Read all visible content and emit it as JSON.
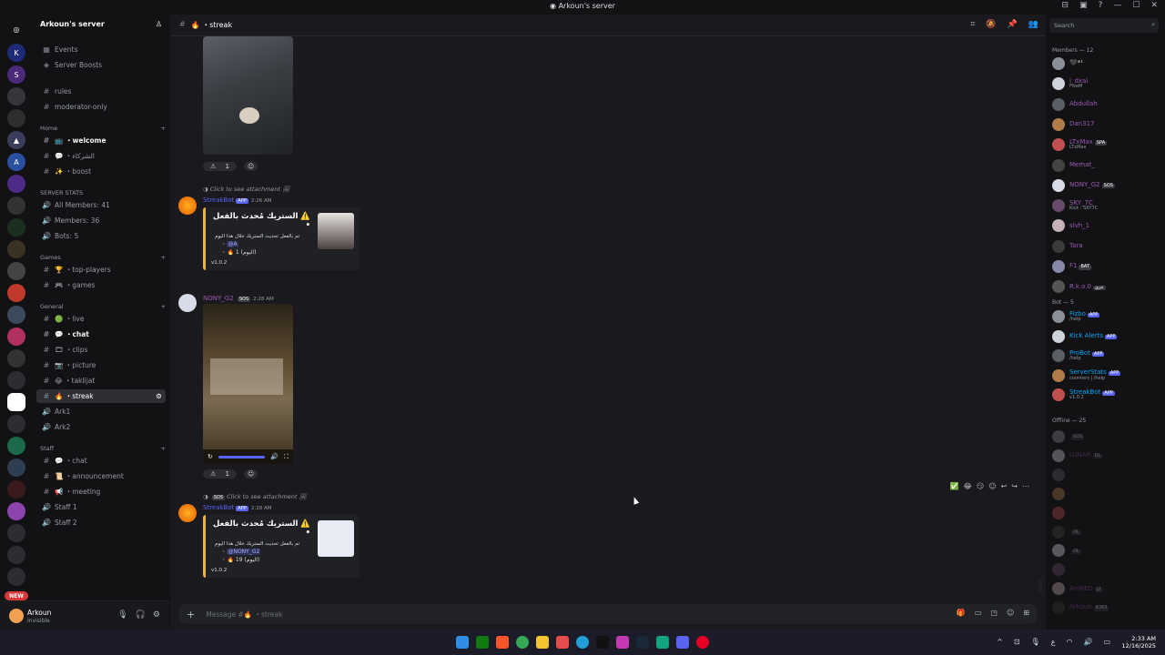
{
  "window": {
    "title": "Arkoun's server",
    "controls": [
      "pin",
      "inbox",
      "help",
      "minimize",
      "maximize",
      "close"
    ]
  },
  "sidebar": {
    "server_name": "Arkoun's server",
    "top_items": [
      {
        "label": "Events"
      },
      {
        "label": "Server Boosts"
      }
    ],
    "channels_top": [
      {
        "label": "rules"
      },
      {
        "label": "moderator-only"
      }
    ],
    "categories": [
      {
        "name": "Home",
        "channels": [
          {
            "label": "📺 ・welcome"
          },
          {
            "label": "💬 ・الشركاء"
          },
          {
            "label": "✨ ・boost"
          }
        ]
      },
      {
        "name": "SERVER STATS",
        "channels": [
          {
            "label": "All Members: 41"
          },
          {
            "label": "Members: 36"
          },
          {
            "label": "Bots: 5"
          }
        ]
      },
      {
        "name": "Games",
        "channels": [
          {
            "label": "🏆 ・top-players"
          },
          {
            "label": "🎮 ・games"
          }
        ]
      },
      {
        "name": "General",
        "channels": [
          {
            "label": "🟢 ・live"
          },
          {
            "label": "💬 ・chat"
          },
          {
            "label": "🎞 ・clips"
          },
          {
            "label": "📷 ・picture"
          },
          {
            "label": "😂 ・taklijat"
          },
          {
            "label": "🔥 ・streak"
          },
          {
            "label": "Ark1"
          },
          {
            "label": "Ark2"
          }
        ]
      },
      {
        "name": "Staff",
        "channels": [
          {
            "label": "💬 ・chat"
          },
          {
            "label": "📜 ・announcement"
          },
          {
            "label": "📢 ・meeting"
          },
          {
            "label": "Staff 1"
          },
          {
            "label": "Staff 2"
          }
        ]
      }
    ],
    "user": {
      "name": "Arkoun",
      "status": "Invisible"
    }
  },
  "channel": {
    "name": "🔥 ・streak"
  },
  "messages": [
    {
      "reaction_count": "1"
    },
    {
      "reply_text": "Click to see attachment",
      "author": "StreakBot",
      "tag": "APP",
      "time": "2:26 AM",
      "embed": {
        "title": "⚠️ الستريك مُحدث بالفعل •",
        "desc": "تم بالفعل تحديث الستريك خلال هذا اليوم",
        "mention": "@A",
        "count": "1 (اليوم)",
        "version": "v1.0.2"
      }
    },
    {
      "author": "NONY_G2",
      "badge": "SOS",
      "time": "2:28 AM",
      "reaction_count": "1"
    },
    {
      "reply_text": "Click to see attachment",
      "reply_badge": "SOS",
      "author": "StreakBot",
      "tag": "APP",
      "time": "2:28 AM",
      "embed": {
        "title": "⚠️ الستريك مُحدث بالفعل •",
        "desc": "تم بالفعل تحديث الستريك خلال هذا اليوم",
        "mention": "@NONY_G2",
        "count": "19 (اليوم)",
        "version": "v1.0.2"
      }
    }
  ],
  "composer": {
    "placeholder": "Message #🔥 ・streak"
  },
  "members": {
    "search_placeholder": "Search",
    "online_header": "Members — 12",
    "online": [
      {
        "name": "🖤*¹",
        "sub": "",
        "color": "#dbdee1"
      },
      {
        "name": "i_dxai",
        "sub": "FiveM",
        "color": "#9b59b6"
      },
      {
        "name": "Abdullah",
        "sub": "",
        "color": "#9b59b6"
      },
      {
        "name": "Dan317",
        "sub": "",
        "color": "#9b59b6"
      },
      {
        "name": "LTxMax",
        "badge": "SPA",
        "sub": "LTxMax",
        "color": "#9b59b6"
      },
      {
        "name": "Memat_",
        "sub": "",
        "color": "#9b59b6"
      },
      {
        "name": "NONY_G2",
        "badge": "SOS",
        "sub": "",
        "color": "#9b59b6"
      },
      {
        "name": "SKY_7C",
        "sub": "Kick : SKY7C",
        "color": "#9b59b6"
      },
      {
        "name": "slvh_1",
        "sub": "",
        "color": "#9b59b6"
      },
      {
        "name": "Tara",
        "sub": "",
        "color": "#9b59b6"
      },
      {
        "name": "F1",
        "badge": "BAT",
        "sub": "",
        "color": "#9b59b6"
      },
      {
        "name": "R.k.o.0",
        "badge": "عزي",
        "sub": "",
        "color": "#9b59b6"
      }
    ],
    "bot_header": "Bot — 5",
    "bots": [
      {
        "name": "Fizbo",
        "tag": "APP",
        "sub": "/help"
      },
      {
        "name": "Kick Alerts",
        "tag": "APP",
        "sub": ""
      },
      {
        "name": "ProBot",
        "tag": "APP",
        "sub": "/help"
      },
      {
        "name": "ServerStats",
        "tag": "APP",
        "sub": "counters | /help"
      },
      {
        "name": "StreakBot",
        "tag": "APP",
        "sub": "v1.0.2"
      }
    ],
    "offline_header": "Offline — 25",
    "offline": [
      {
        "name": "",
        "badge": "SOS"
      },
      {
        "name": "LUNAR",
        "badge": "OL"
      },
      {
        "name": ""
      },
      {
        "name": ""
      },
      {
        "name": ""
      },
      {
        "name": "",
        "badge": "OL"
      },
      {
        "name": "",
        "badge": "OL"
      },
      {
        "name": ""
      },
      {
        "name": "AHMED",
        "badge": "J2"
      },
      {
        "name": "Arkoun",
        "badge": "6363"
      }
    ]
  },
  "taskbar": {
    "time": "2:33 AM",
    "date": "12/16/2025"
  }
}
